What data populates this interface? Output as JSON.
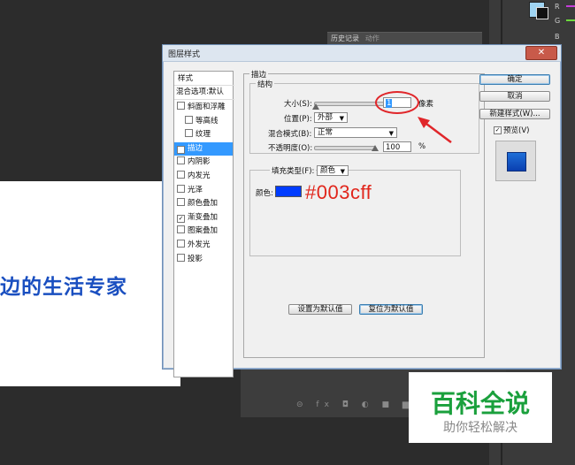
{
  "background": {
    "canvas_text": "边的生活专家",
    "history_tab": "历史记录",
    "history_tab2": "动作",
    "panel_bottom_icons": "⊝ fx ◘ ◐ ■ ▆ 🗑",
    "swatch_labels": [
      "R",
      "G",
      "B"
    ]
  },
  "dialog": {
    "title": "图层样式",
    "close_symbol": "✕",
    "styles_list": [
      {
        "label": "样式",
        "checkbox": false,
        "checked": false,
        "selected": false,
        "kind": "header"
      },
      {
        "label": "混合选项:默认",
        "checkbox": false,
        "checked": false,
        "selected": false,
        "kind": "blend"
      },
      {
        "label": "斜面和浮雕",
        "checkbox": true,
        "checked": false,
        "selected": false,
        "kind": "item"
      },
      {
        "label": "等高线",
        "checkbox": true,
        "checked": false,
        "selected": false,
        "kind": "sub"
      },
      {
        "label": "纹理",
        "checkbox": true,
        "checked": false,
        "selected": false,
        "kind": "sub"
      },
      {
        "label": "描边",
        "checkbox": true,
        "checked": true,
        "selected": true,
        "kind": "item"
      },
      {
        "label": "内阴影",
        "checkbox": true,
        "checked": false,
        "selected": false,
        "kind": "item"
      },
      {
        "label": "内发光",
        "checkbox": true,
        "checked": false,
        "selected": false,
        "kind": "item"
      },
      {
        "label": "光泽",
        "checkbox": true,
        "checked": false,
        "selected": false,
        "kind": "item"
      },
      {
        "label": "颜色叠加",
        "checkbox": true,
        "checked": false,
        "selected": false,
        "kind": "item"
      },
      {
        "label": "渐变叠加",
        "checkbox": true,
        "checked": true,
        "selected": false,
        "kind": "item"
      },
      {
        "label": "图案叠加",
        "checkbox": true,
        "checked": false,
        "selected": false,
        "kind": "item"
      },
      {
        "label": "外发光",
        "checkbox": true,
        "checked": false,
        "selected": false,
        "kind": "item"
      },
      {
        "label": "投影",
        "checkbox": true,
        "checked": false,
        "selected": false,
        "kind": "item"
      }
    ],
    "stroke": {
      "group_title": "描边",
      "structure_title": "结构",
      "size_label": "大小(S):",
      "size_value": "1",
      "size_unit": "像素",
      "position_label": "位置(P):",
      "position_value": "外部",
      "blend_label": "混合模式(B):",
      "blend_value": "正常",
      "opacity_label": "不透明度(O):",
      "opacity_value": "100",
      "opacity_unit": "%",
      "fill_type_label": "填充类型(F):",
      "fill_type_value": "颜色",
      "color_label": "颜色:",
      "color_hex": "#003cff",
      "btn_set_default": "设置为默认值",
      "btn_reset_default": "复位为默认值"
    },
    "buttons": {
      "ok": "确定",
      "cancel": "取消",
      "new_style": "新建样式(W)...",
      "preview_label": "预览(V)",
      "preview_checked": true
    }
  },
  "annotation": {
    "color_text": "#003cff",
    "color": "#e0262a"
  },
  "watermark": {
    "main": "百科全说",
    "sub": "助你轻松解决"
  },
  "colors": {
    "selection_blue": "#3399ff",
    "stroke_color": "#003cff",
    "brand_green": "#1aa03c"
  }
}
